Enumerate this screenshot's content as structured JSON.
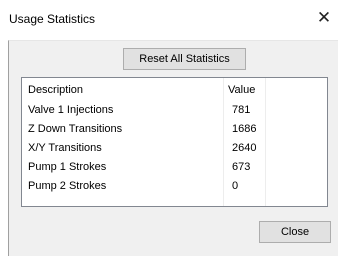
{
  "window": {
    "title": "Usage  Statistics",
    "close_glyph": "✕"
  },
  "toolbar": {
    "reset_label": "Reset All Statistics"
  },
  "table": {
    "columns": [
      "Description",
      "Value"
    ],
    "rows": [
      {
        "description": "Valve 1 Injections",
        "value": "781"
      },
      {
        "description": "Z Down Transitions",
        "value": "1686"
      },
      {
        "description": "X/Y Transitions",
        "value": "2640"
      },
      {
        "description": "Pump 1 Strokes",
        "value": "673"
      },
      {
        "description": "Pump 2 Strokes",
        "value": "0"
      }
    ]
  },
  "footer": {
    "close_label": "Close"
  }
}
